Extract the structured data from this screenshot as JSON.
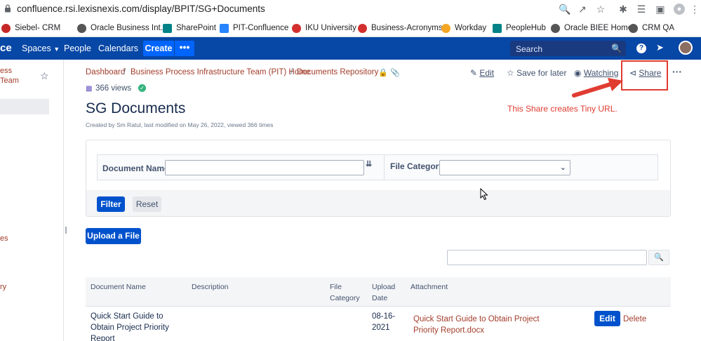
{
  "browser": {
    "url": "confluence.rsi.lexisnexis.com/display/BPIT/SG+Documents"
  },
  "bookmarks": [
    {
      "label": "Siebel- CRM",
      "color": "#c62828"
    },
    {
      "label": "Oracle Business Int...",
      "color": "#555555"
    },
    {
      "label": "SharePoint",
      "color": "#038387"
    },
    {
      "label": "PIT-Confluence",
      "color": "#2684ff"
    },
    {
      "label": "IKU University",
      "color": "#d32f2f"
    },
    {
      "label": "Business-Acronyms",
      "color": "#d32f2f"
    },
    {
      "label": "Workday",
      "color": "#f5a623"
    },
    {
      "label": "PeopleHub",
      "color": "#038387"
    },
    {
      "label": "Oracle BIEE Home",
      "color": "#555555"
    },
    {
      "label": "CRM QA",
      "color": "#555555"
    }
  ],
  "topnav": {
    "logo_fragment": "ce",
    "spaces": "Spaces",
    "people": "People",
    "calendars": "Calendars",
    "create": "Create",
    "more": "•••",
    "search_placeholder": "Search"
  },
  "sidebar": {
    "space_name_line1": "ess",
    "space_name_line2": "Team",
    "item_a": "es",
    "item_b": "ry"
  },
  "breadcrumb": {
    "dashboard": "Dashboard",
    "team_home": "Business Process Infrastructure Team (PIT) Home",
    "repo": "Documents Repository"
  },
  "page_actions": {
    "edit": "Edit",
    "save_for_later": "Save for later",
    "watching": "Watching",
    "share": "Share"
  },
  "page": {
    "views": "366 views",
    "title": "SG Documents",
    "byline": "Created by Sm Ratul, last modified on May 26, 2022, viewed 366 times"
  },
  "annotation": {
    "text": "This Share creates Tiny URL."
  },
  "filter": {
    "document_name_label": "Document Name:",
    "document_name_value": "",
    "file_category_label": "File Category:",
    "file_category_value": "",
    "filter_button": "Filter",
    "reset_button": "Reset"
  },
  "upload_button": "Upload a File",
  "table_search_value": "",
  "table": {
    "headers": {
      "doc_name": "Document Name",
      "description": "Description",
      "file_category": "File Category",
      "upload_date": "Upload Date",
      "attachment": "Attachment"
    },
    "rows": [
      {
        "doc_name": "Quick Start Guide to Obtain Project Priority Report",
        "description": "",
        "file_category": "",
        "upload_date": "08-16-2021",
        "attachment": "Quick Start Guide to Obtain Project Priority Report.docx",
        "edit": "Edit",
        "delete": "Delete"
      }
    ]
  }
}
